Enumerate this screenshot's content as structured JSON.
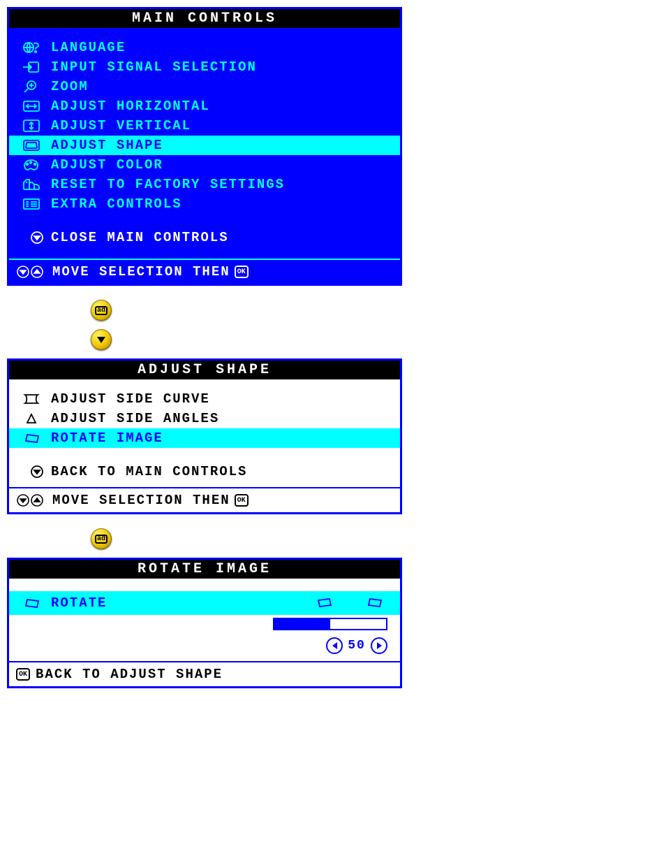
{
  "main": {
    "title": "MAIN CONTROLS",
    "items": [
      {
        "label": "LANGUAGE",
        "icon": "language-icon"
      },
      {
        "label": "INPUT SIGNAL SELECTION",
        "icon": "input-icon"
      },
      {
        "label": "ZOOM",
        "icon": "zoom-icon"
      },
      {
        "label": "ADJUST HORIZONTAL",
        "icon": "horiz-icon"
      },
      {
        "label": "ADJUST VERTICAL",
        "icon": "vert-icon"
      },
      {
        "label": "ADJUST SHAPE",
        "icon": "shape-icon"
      },
      {
        "label": "ADJUST COLOR",
        "icon": "color-icon"
      },
      {
        "label": "RESET TO FACTORY SETTINGS",
        "icon": "reset-icon"
      },
      {
        "label": "EXTRA CONTROLS",
        "icon": "extra-icon"
      }
    ],
    "close": "CLOSE MAIN CONTROLS",
    "footer": "MOVE SELECTION THEN",
    "footer_ok": "OK"
  },
  "shape": {
    "title": "ADJUST SHAPE",
    "items": [
      {
        "label": "ADJUST SIDE CURVE",
        "icon": "side-curve-icon"
      },
      {
        "label": "ADJUST SIDE ANGLES",
        "icon": "side-angle-icon"
      },
      {
        "label": "ROTATE IMAGE",
        "icon": "rotate-icon"
      }
    ],
    "back": "BACK TO MAIN CONTROLS",
    "footer": "MOVE SELECTION THEN",
    "footer_ok": "OK"
  },
  "rotate": {
    "title": "ROTATE IMAGE",
    "option": "ROTATE",
    "value": 50,
    "slider_percent": 50,
    "back": "BACK TO ADJUST SHAPE",
    "back_ok": "OK"
  }
}
